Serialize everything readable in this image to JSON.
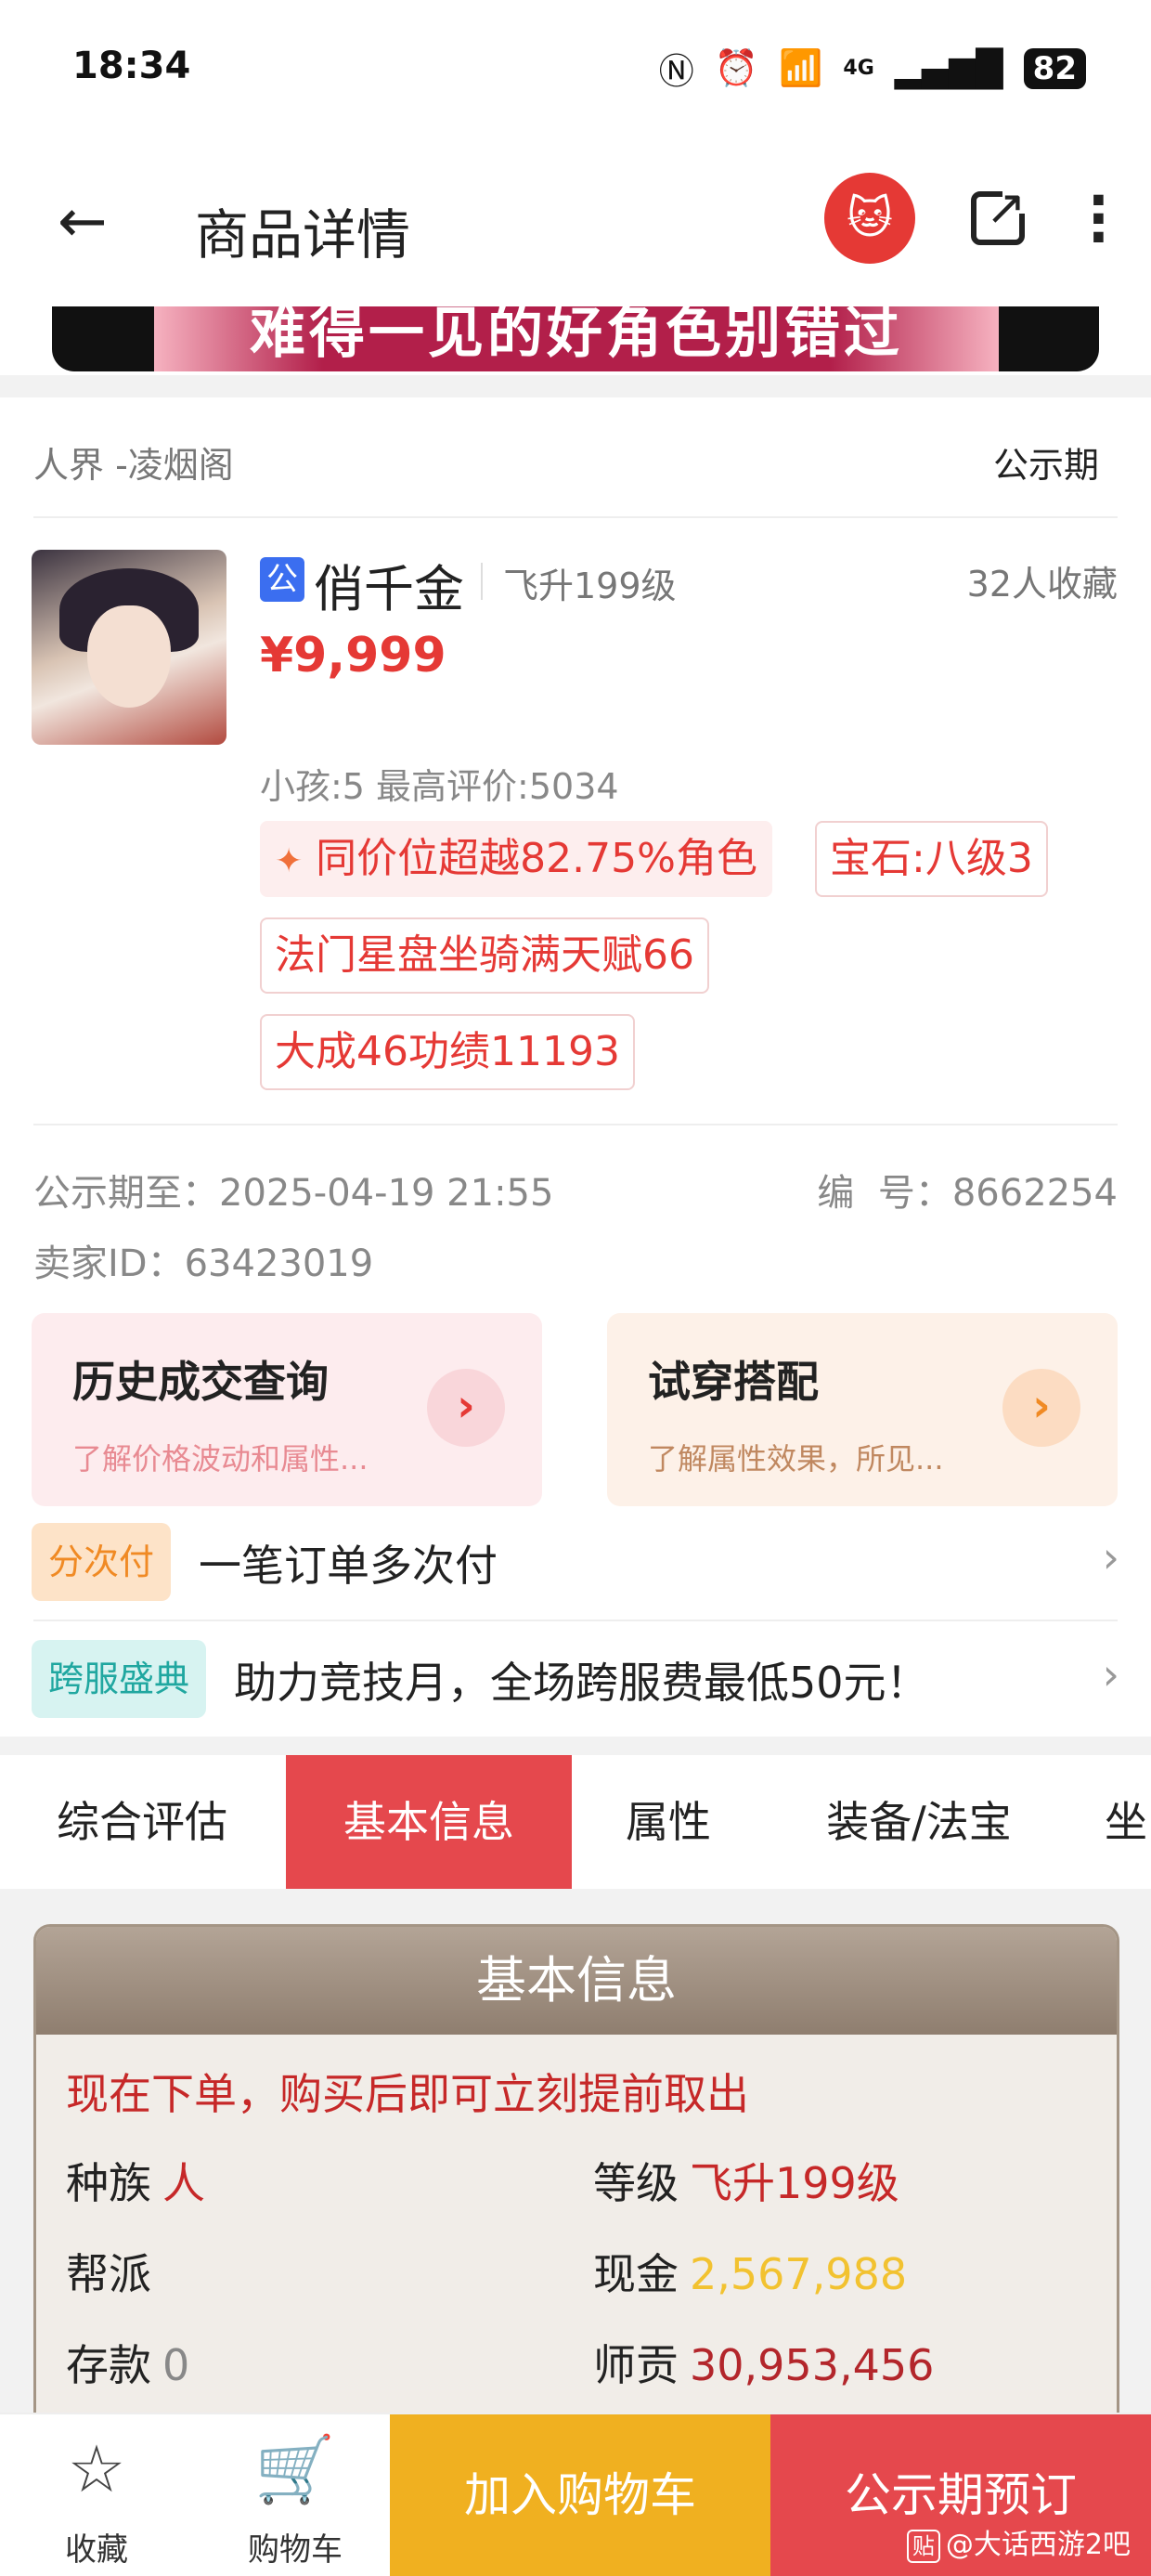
{
  "status_bar": {
    "time": "18:34",
    "network": "4G",
    "battery": "82"
  },
  "header": {
    "title": "商品详情"
  },
  "banner": {
    "text": "难得一见的好角色别错过"
  },
  "server": {
    "name": "人界 -凌烟阁",
    "status": "公示期"
  },
  "product": {
    "badge": "公",
    "name": "俏千金",
    "level": "飞升199级",
    "favorites": "32人收藏",
    "price": "¥9,999",
    "sub_info": "小孩:5 最高评价:5034",
    "tags": [
      "同价位超越82.75%角色",
      "宝石:八级3",
      "法门星盘坐骑满天赋66",
      "大成46功绩11193"
    ],
    "public_until_label": "公示期至：",
    "public_until": "2025-04-19 21:55",
    "serial_label": "编  号：",
    "serial": "8662254",
    "seller_label": "卖家ID：",
    "seller_id": "63423019"
  },
  "cards": {
    "history": {
      "title": "历史成交查询",
      "subtitle": "了解价格波动和属性..."
    },
    "tryon": {
      "title": "试穿搭配",
      "subtitle": "了解属性效果，所见..."
    }
  },
  "promos": [
    {
      "badge": "分次付",
      "text": "一笔订单多次付"
    },
    {
      "badge": "跨服盛典",
      "text": "助力竞技月，全场跨服费最低50元！"
    }
  ],
  "tabs": [
    "综合评估",
    "基本信息",
    "属性",
    "装备/法宝",
    "坐"
  ],
  "active_tab": 1,
  "basic_info": {
    "title": "基本信息",
    "note": "现在下单，购买后即可立刻提前取出",
    "race_label": "种族",
    "race": "人",
    "level_label": "等级",
    "level": "飞升199级",
    "guild_label": "帮派",
    "guild": "",
    "cash_label": "现金",
    "cash": "2,567,988",
    "deposit_label": "存款",
    "deposit": "0",
    "mentor_label": "师贡",
    "mentor": "30,953,456"
  },
  "bottom_bar": {
    "favorite": "收藏",
    "cart": "购物车",
    "add_to_cart": "加入购物车",
    "reserve": "公示期预订"
  },
  "watermark": {
    "icon": "贴",
    "text": "@大话西游2吧"
  }
}
